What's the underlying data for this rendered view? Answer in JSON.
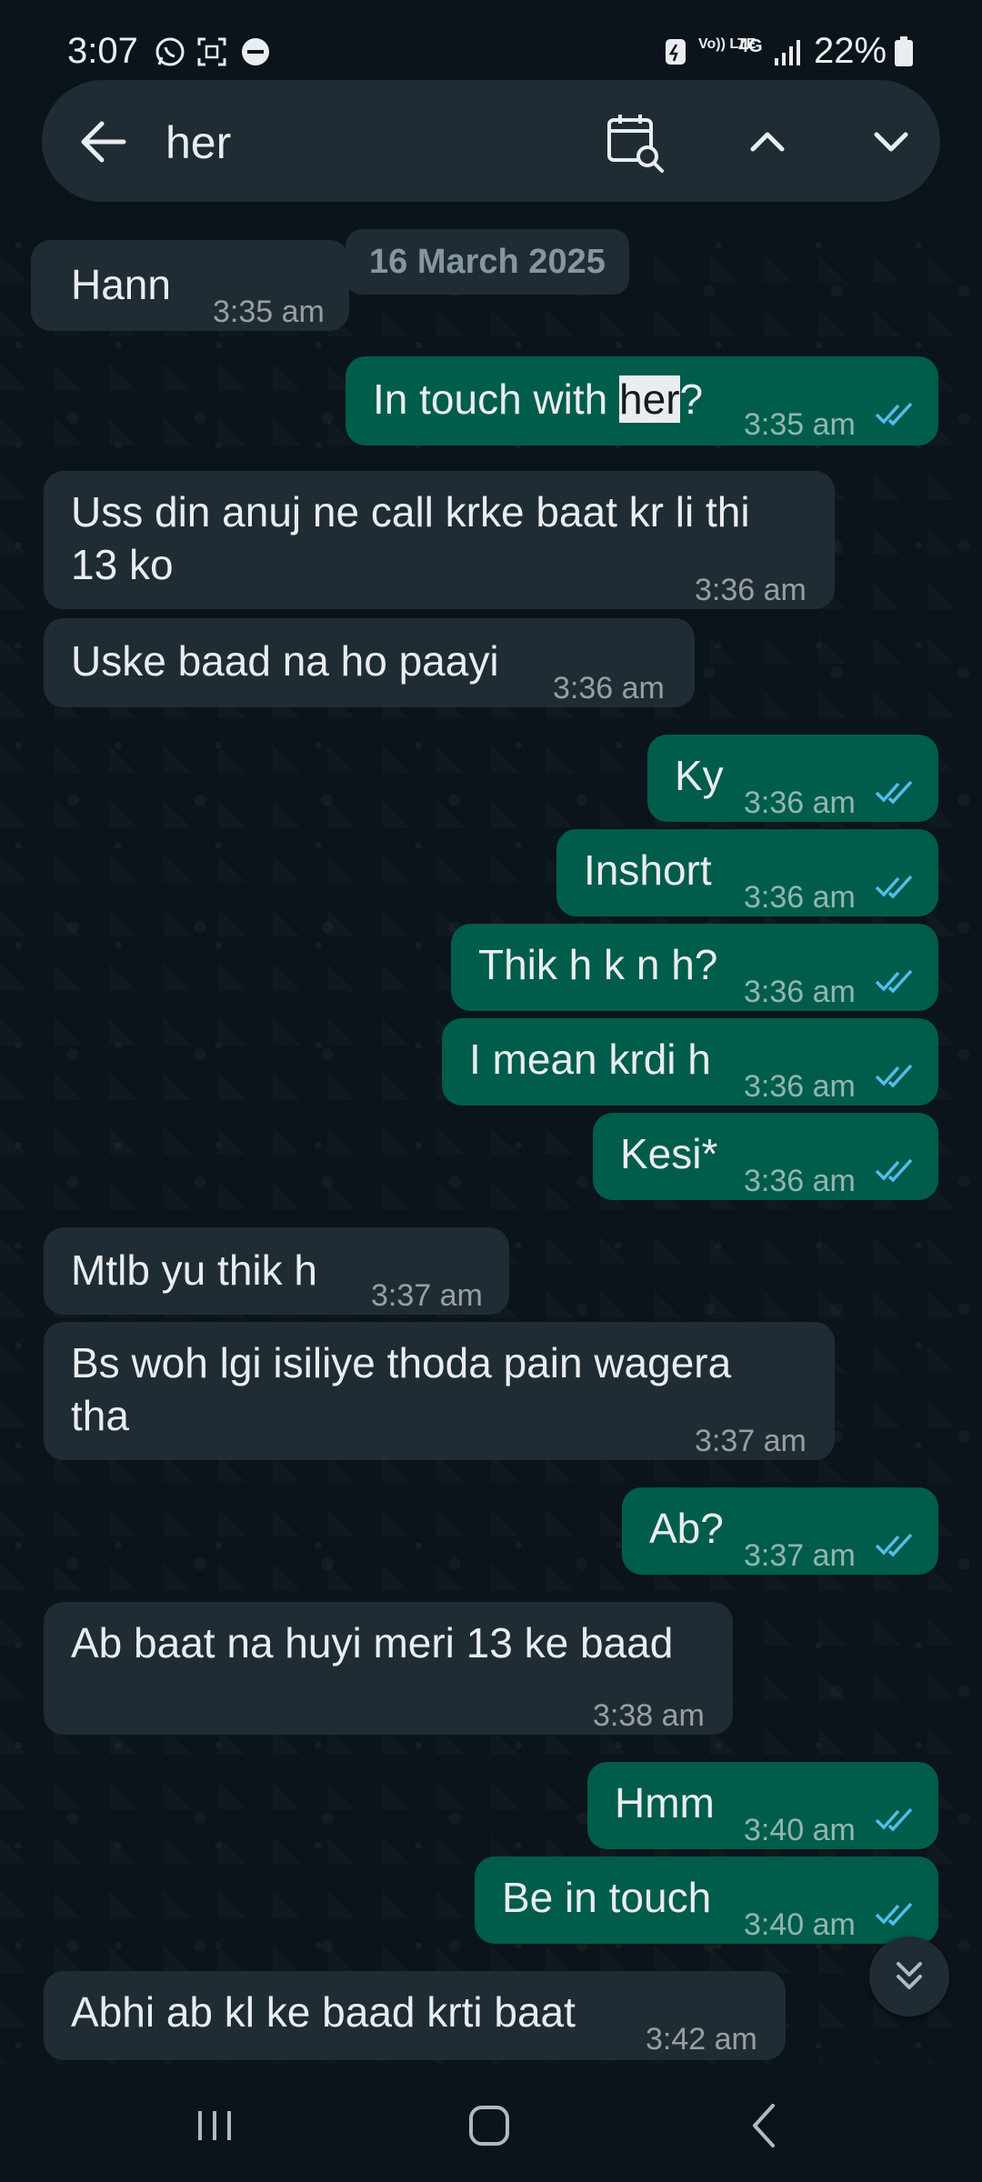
{
  "status_bar": {
    "time": "3:07",
    "battery": "22%",
    "network": "4G",
    "volte": "Vo)) LTE"
  },
  "search": {
    "query": "her",
    "icons": [
      "back-arrow-icon",
      "calendar-search-icon",
      "chevron-up-icon",
      "chevron-down-icon"
    ]
  },
  "date_chip": "16 March 2025",
  "messages": [
    {
      "dir": "in",
      "text": "Hann",
      "time": "3:35 am"
    },
    {
      "dir": "out",
      "text_before": "In touch with ",
      "highlight": "her",
      "text_after": "?",
      "time": "3:35 am",
      "read": true
    },
    {
      "dir": "in",
      "text": "Uss din anuj ne call krke baat kr li thi\n13 ko",
      "time": "3:36 am"
    },
    {
      "dir": "in",
      "text": "Uske baad na ho paayi",
      "time": "3:36 am"
    },
    {
      "dir": "out",
      "text": "Ky",
      "time": "3:36 am",
      "read": true
    },
    {
      "dir": "out",
      "text": "Inshort",
      "time": "3:36 am",
      "read": true
    },
    {
      "dir": "out",
      "text": "Thik h k n h?",
      "time": "3:36 am",
      "read": true
    },
    {
      "dir": "out",
      "text": "I mean krdi h",
      "time": "3:36 am",
      "read": true
    },
    {
      "dir": "out",
      "text": "Kesi*",
      "time": "3:36 am",
      "read": true
    },
    {
      "dir": "in",
      "text": "Mtlb yu thik h",
      "time": "3:37 am"
    },
    {
      "dir": "in",
      "text": "Bs woh lgi isiliye thoda pain wagera\ntha",
      "time": "3:37 am"
    },
    {
      "dir": "out",
      "text": "Ab?",
      "time": "3:37 am",
      "read": true
    },
    {
      "dir": "in",
      "text": "Ab baat na huyi meri 13 ke baad",
      "time": "3:38 am"
    },
    {
      "dir": "out",
      "text": "Hmm",
      "time": "3:40 am",
      "read": true
    },
    {
      "dir": "out",
      "text": "Be in touch",
      "time": "3:40 am",
      "read": true
    },
    {
      "dir": "in",
      "text": "Abhi ab kl ke baad krti baat",
      "time": "3:42 am"
    }
  ],
  "colors": {
    "background": "#0b141a",
    "incoming_bubble": "#202c33",
    "outgoing_bubble": "#005c4b",
    "read_tick": "#53bdeb",
    "accent": "#00a884"
  }
}
